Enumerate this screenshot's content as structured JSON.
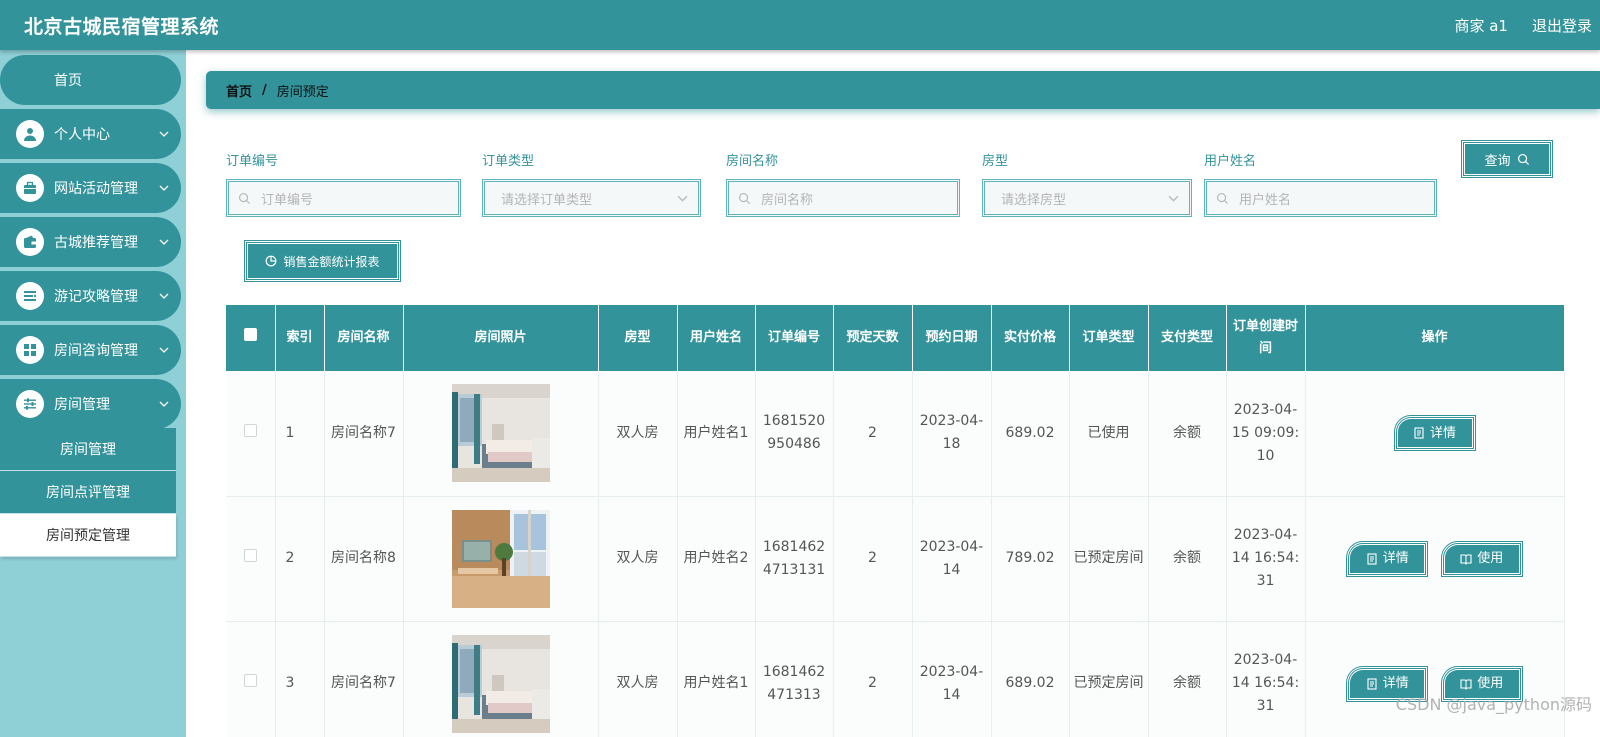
{
  "header": {
    "title": "北京古城民宿管理系统",
    "user": "商家 a1",
    "logout": "退出登录"
  },
  "sidebar": {
    "home": "首页",
    "menus": [
      {
        "label": "个人中心",
        "icon": "user-icon"
      },
      {
        "label": "网站活动管理",
        "icon": "briefcase-icon"
      },
      {
        "label": "古城推荐管理",
        "icon": "wallet-icon"
      },
      {
        "label": "游记攻略管理",
        "icon": "list-icon"
      },
      {
        "label": "房间咨询管理",
        "icon": "grid-icon"
      },
      {
        "label": "房间管理",
        "icon": "sliders-icon"
      }
    ],
    "submenu": [
      "房间管理",
      "房间点评管理",
      "房间预定管理"
    ]
  },
  "breadcrumb": {
    "home": "首页",
    "separator": "/",
    "current": "房间预定"
  },
  "search": {
    "fields": [
      {
        "label": "订单编号",
        "placeholder": "订单编号"
      },
      {
        "label": "订单类型",
        "placeholder": "请选择订单类型"
      },
      {
        "label": "房间名称",
        "placeholder": "房间名称"
      },
      {
        "label": "房型",
        "placeholder": "请选择房型"
      },
      {
        "label": "用户姓名",
        "placeholder": "用户姓名"
      }
    ],
    "query_label": "查询",
    "report_label": "销售金额统计报表"
  },
  "table": {
    "headers": [
      "索引",
      "房间名称",
      "房间照片",
      "房型",
      "用户姓名",
      "订单编号",
      "预定天数",
      "预约日期",
      "实付价格",
      "订单类型",
      "支付类型",
      "订单创建时间",
      "操作"
    ],
    "rows": [
      {
        "index": "1",
        "room_name": "房间名称7",
        "room_type": "双人房",
        "user_name": "用户姓名1",
        "order_no": "1681520950486",
        "days": "2",
        "date": "2023-04-18",
        "price": "689.02",
        "order_type": "已使用",
        "pay_type": "余额",
        "created": "2023-04-15 09:09:10",
        "actions": [
          "详情"
        ]
      },
      {
        "index": "2",
        "room_name": "房间名称8",
        "room_type": "双人房",
        "user_name": "用户姓名2",
        "order_no": "16814624713131",
        "days": "2",
        "date": "2023-04-14",
        "price": "789.02",
        "order_type": "已预定房间",
        "pay_type": "余额",
        "created": "2023-04-14 16:54:31",
        "actions": [
          "详情",
          "使用"
        ]
      },
      {
        "index": "3",
        "room_name": "房间名称7",
        "room_type": "双人房",
        "user_name": "用户姓名1",
        "order_no": "1681462471313",
        "days": "2",
        "date": "2023-04-14",
        "price": "689.02",
        "order_type": "已预定房间",
        "pay_type": "余额",
        "created": "2023-04-14 16:54:31",
        "actions": [
          "详情",
          "使用"
        ]
      }
    ]
  },
  "watermark": "CSDN @java_python源码",
  "colors": {
    "primary": "#33939b",
    "sidebar_bg": "#8fd0d6",
    "accent_border": "#5fb3ba"
  }
}
